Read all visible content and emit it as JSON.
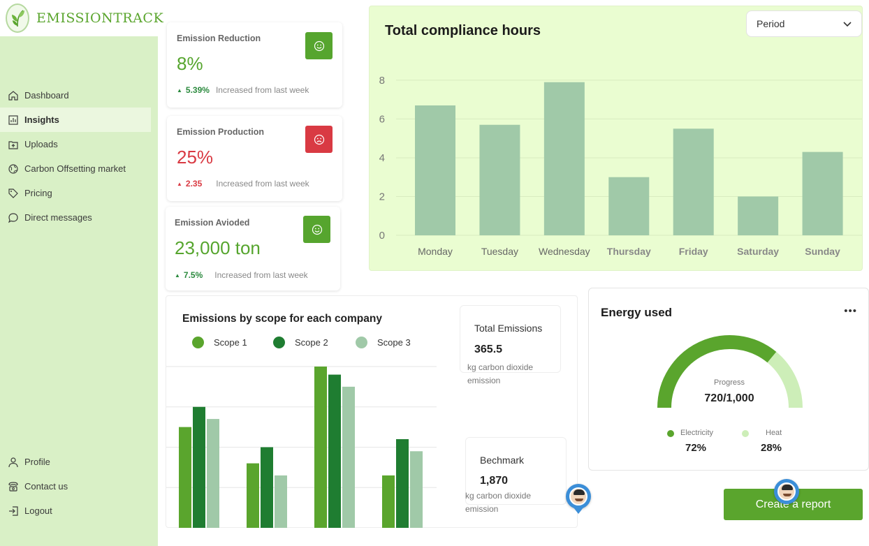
{
  "app": {
    "name": "EMISSIONTRACK"
  },
  "sidebar": {
    "items": [
      {
        "label": "Dashboard",
        "icon": "home-icon"
      },
      {
        "label": "Insights",
        "icon": "chart-icon",
        "active": true
      },
      {
        "label": "Uploads",
        "icon": "upload-icon"
      },
      {
        "label": "Carbon Offsetting market",
        "icon": "globe-icon"
      },
      {
        "label": "Pricing",
        "icon": "tag-icon"
      },
      {
        "label": "Direct messages",
        "icon": "chat-icon"
      }
    ],
    "bottom": [
      {
        "label": "Profile",
        "icon": "user-icon"
      },
      {
        "label": "Contact us",
        "icon": "phone-icon"
      },
      {
        "label": "Logout",
        "icon": "logout-icon"
      }
    ]
  },
  "kpis": {
    "reduction": {
      "title": "Emission Reduction",
      "value": "8%",
      "change": "5.39%",
      "note": "Increased from last week",
      "icon": "smile-icon",
      "accent": "#56a52e"
    },
    "production": {
      "title": "Emission Production",
      "value": "25%",
      "change": "2.35",
      "note": "Increased from last week",
      "icon": "frown-icon",
      "accent": "#d93a43"
    },
    "avoided": {
      "title": "Emission Avioded",
      "value": "23,000 ton",
      "change": "7.5%",
      "note": "Increased from last week",
      "icon": "smile-icon",
      "accent": "#56a52e"
    }
  },
  "compliance": {
    "title": "Total compliance hours",
    "period_label": "Period"
  },
  "scope": {
    "title": "Emissions by scope for each company",
    "legend": [
      "Scope 1",
      "Scope 2",
      "Scope 3"
    ]
  },
  "totals": {
    "total": {
      "label": "Total  Emissions",
      "value": "365.5",
      "unit": "kg carbon dioxide emission"
    },
    "benchmark": {
      "label": "Bechmark",
      "value": "1,870",
      "unit": "kg carbon dioxide emission"
    }
  },
  "energy": {
    "title": "Energy used",
    "more": "•••",
    "progress_label": "Progress",
    "progress_value": "720/1,000",
    "progress_fraction": 0.72,
    "legend": [
      {
        "name": "Electricity",
        "pct": "72%",
        "color": "#5aa52d"
      },
      {
        "name": "Heat",
        "pct": "28%",
        "color": "#cdeeb8"
      }
    ]
  },
  "actions": {
    "create_report": "Create a report"
  },
  "colors": {
    "primary": "#5aa52d",
    "bar": "#a0c9a8",
    "scope1": "#5aa52d",
    "scope2": "#1f7d31",
    "scope3": "#a0c9a8"
  },
  "chart_data": [
    {
      "type": "bar",
      "title": "Total compliance hours",
      "categories": [
        "Monday",
        "Tuesday",
        "Wednesday",
        "Thursday",
        "Friday",
        "Saturday",
        "Sunday"
      ],
      "values": [
        6.7,
        5.7,
        7.9,
        3.0,
        5.5,
        2.0,
        4.3
      ],
      "yticks": [
        0,
        2,
        4,
        6,
        8
      ],
      "ylim": [
        0,
        8.5
      ],
      "grid": true
    },
    {
      "type": "bar",
      "title": "Emissions by scope for each company",
      "categories": [
        "",
        "",
        "",
        ""
      ],
      "series": [
        {
          "name": "Scope 1",
          "values": [
            2.5,
            1.6,
            4.0,
            1.3
          ]
        },
        {
          "name": "Scope 2",
          "values": [
            3.0,
            2.0,
            3.8,
            2.2
          ]
        },
        {
          "name": "Scope 3",
          "values": [
            2.7,
            1.3,
            3.5,
            1.9
          ]
        }
      ],
      "ylim": [
        0,
        4
      ],
      "grid": true,
      "legend": "top"
    }
  ]
}
